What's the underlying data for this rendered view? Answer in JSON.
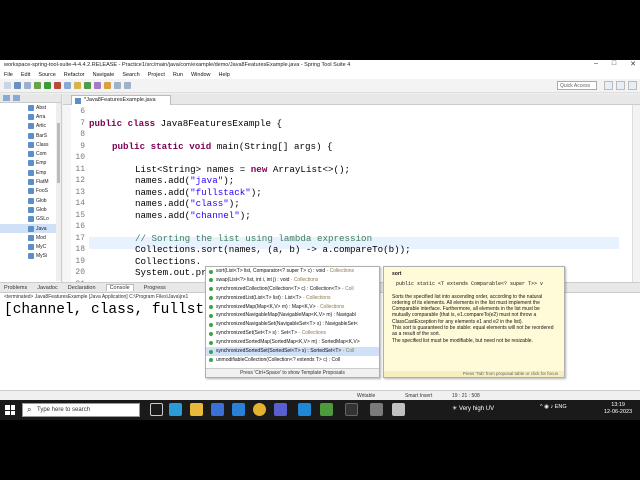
{
  "window": {
    "title": "workspace-spring-tool-suite-4-4.4.2.RELEASE - Practice1/src/main/java/com/example/demo/Java8FeaturesExample.java - Spring Tool Suite 4"
  },
  "menu": [
    "File",
    "Edit",
    "Source",
    "Refactor",
    "Navigate",
    "Search",
    "Project",
    "Run",
    "Window",
    "Help"
  ],
  "toolbar": {
    "quick_access_placeholder": "Quick Access"
  },
  "package_explorer": {
    "items": [
      "Abst",
      "Arra",
      "Artic",
      "BarS",
      "Class",
      "Com",
      "Emp",
      "Emp",
      "FlatM",
      "FooS",
      "Glob",
      "Glob",
      "GSLo",
      "Java",
      "Mod",
      "MyC",
      "MySi"
    ]
  },
  "editor": {
    "tab_label": "*Java8FeaturesExample.java",
    "line_numbers": [
      "6",
      "7",
      "8",
      "9",
      "10",
      "11",
      "12",
      "13",
      "14",
      "15",
      "16",
      "17",
      "18",
      "19",
      "20",
      "21",
      "22"
    ]
  },
  "code": {
    "l7_kw": "public class",
    "l7_rest": " Java8FeaturesExample {",
    "l9_kw": "public static void",
    "l9_rest": " main(String[] args) {",
    "l11_a": "List<String> names = ",
    "l11_kw": "new",
    "l11_b": " ArrayList<>();",
    "add_prefix": "names.add(",
    "add_suffix": ");",
    "s1": "\"java\"",
    "s2": "\"fullstack\"",
    "s3": "\"class\"",
    "s4": "\"channel\"",
    "comment": "// Sorting the list using lambda expression",
    "l17": "Collections.sort(names, (a, b) -> a.compareTo(b));",
    "l19": "Collections.",
    "l20": "System.out.pr",
    "l22": "}"
  },
  "bottom_panel": {
    "tabs": [
      "Problems",
      "Javadoc",
      "Declaration",
      "Console",
      "Progress"
    ],
    "console_header": "<terminated> Java8FeaturesExample [Java Application] C:\\Program Files\\Java\\jre1",
    "console_output": "[channel, class, fullstack, j"
  },
  "status_bar": {
    "writable": "Writable",
    "insert_mode": "Smart Insert",
    "position": "19 : 21 : 508"
  },
  "completion": {
    "items": [
      {
        "name": "sort(List<T> list, Comparator<? super T> c) : void",
        "type": " - Collections"
      },
      {
        "name": "swap(List<?> list, int i, int j) : void",
        "type": " - Collections"
      },
      {
        "name": "synchronizedCollection(Collection<T> c) : Collection<T>",
        "type": " - Coll"
      },
      {
        "name": "synchronizedList(List<T> list) : List<T>",
        "type": " - Collections"
      },
      {
        "name": "synchronizedMap(Map<K,V> m) : Map<K,V>",
        "type": " - Collections"
      },
      {
        "name": "synchronizedNavigableMap(NavigableMap<K,V> m) : Navigabl",
        "type": ""
      },
      {
        "name": "synchronizedNavigableSet(NavigableSet<T> s) : NavigableSet<",
        "type": ""
      },
      {
        "name": "synchronizedSet(Set<T> s) : Set<T>",
        "type": " - Collections"
      },
      {
        "name": "synchronizedSortedMap(SortedMap<K,V> m) : SortedMap<K,V>",
        "type": ""
      },
      {
        "name": "synchronizedSortedSet(SortedSet<T> s) : SortedSet<T>",
        "type": " - Coll"
      },
      {
        "name": "unmodifiableCollection(Collection<? extends T> c) : Coll",
        "type": ""
      }
    ],
    "footer": "Press 'Ctrl+Space' to show Template Proposals"
  },
  "javadoc_popup": {
    "title": "sort",
    "signature": "public static <T extends Comparable<? super T>> v",
    "p1": "Sorts the specified list into ascending order, according to the natural ordering of its elements. All elements in the list must implement the Comparable interface. Furthermore, all elements in the list must be mutually comparable (that is, e1.compareTo(e2) must not throw a ClassCastException for any elements e1 and e2 in the list).",
    "p2": "This sort is guaranteed to be stable: equal elements will not be reordered as a result of the sort.",
    "p3": "The specified list must be modifiable, but need not be resizable.",
    "footer": "Press 'Tab' from proposal table or click for focus"
  },
  "taskbar": {
    "search_placeholder": "Type here to search",
    "weather": "Very high UV",
    "lang": "ENG",
    "region": "IN",
    "time": "13:19",
    "date": "12-06-2023"
  },
  "colors": {
    "keyword": "#7f0055",
    "string": "#2a00ff",
    "comment": "#3f7f5f",
    "taskbar": "#1a1a1a"
  }
}
